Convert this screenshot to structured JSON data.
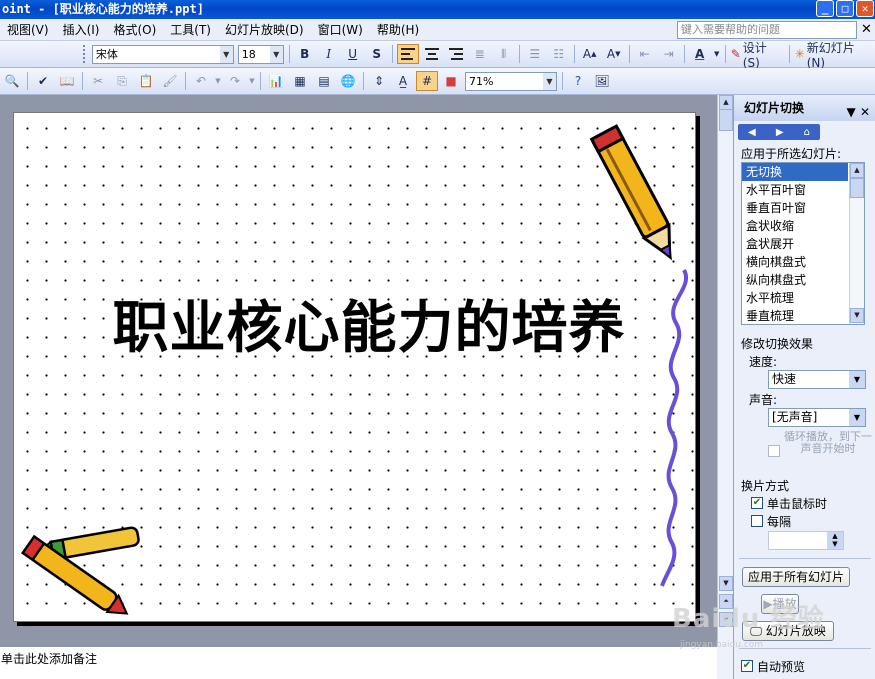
{
  "window": {
    "title": "oint - [职业核心能力的培养.ppt]",
    "controls": [
      "_",
      "□",
      "✕"
    ]
  },
  "menu": {
    "items": [
      "视图(V)",
      "插入(I)",
      "格式(O)",
      "工具(T)",
      "幻灯片放映(D)",
      "窗口(W)",
      "帮助(H)"
    ],
    "help_placeholder": "键入需要帮助的问题",
    "close": "✕"
  },
  "format_toolbar": {
    "font": "宋体",
    "size": "18",
    "bold": "B",
    "italic": "I",
    "underline": "U",
    "shadow": "S",
    "font_color": "A",
    "design_label": "设计(S)",
    "new_slide_label": "新幻灯片(N)"
  },
  "standard_toolbar": {
    "zoom": "71%"
  },
  "slide": {
    "title": "职业核心能力的培养"
  },
  "notes": {
    "placeholder": "单击此处添加备注"
  },
  "task_pane": {
    "title": "幻灯片切换",
    "close": "✕",
    "apply_label": "应用于所选幻灯片:",
    "transitions": [
      "无切换",
      "水平百叶窗",
      "垂直百叶窗",
      "盒状收缩",
      "盒状展开",
      "横向棋盘式",
      "纵向棋盘式",
      "水平梳理",
      "垂直梳理"
    ],
    "selected_index": 0,
    "modify_label": "修改切换效果",
    "speed_label": "速度:",
    "speed_value": "快速",
    "sound_label": "声音:",
    "sound_value": "[无声音]",
    "loop_label": "循环播放，到下一声音开始时",
    "advance_label": "换片方式",
    "on_click_label": "单击鼠标时",
    "on_click_checked": true,
    "every_label": "每隔",
    "every_checked": false,
    "apply_all_label": "应用于所有幻灯片",
    "play_label": "播放",
    "slideshow_label": "幻灯片放映",
    "auto_preview_label": "自动预览",
    "auto_preview_checked": true
  },
  "watermark": {
    "text": "Baidu 经验",
    "url_text": "jingyan.baidu.com"
  },
  "colors": {
    "accent": "#316ac5",
    "title_bar": "#0046c7",
    "menubar": "#eaeef8"
  }
}
